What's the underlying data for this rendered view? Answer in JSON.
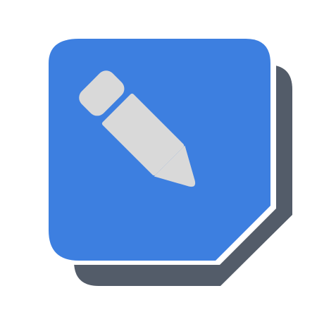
{
  "app_icon": {
    "icon": "pencil-icon",
    "colors": {
      "tile": "#3d7fe0",
      "shadow": "#535c69",
      "border": "#ffffff",
      "glyph": "#d9d9d9"
    }
  }
}
